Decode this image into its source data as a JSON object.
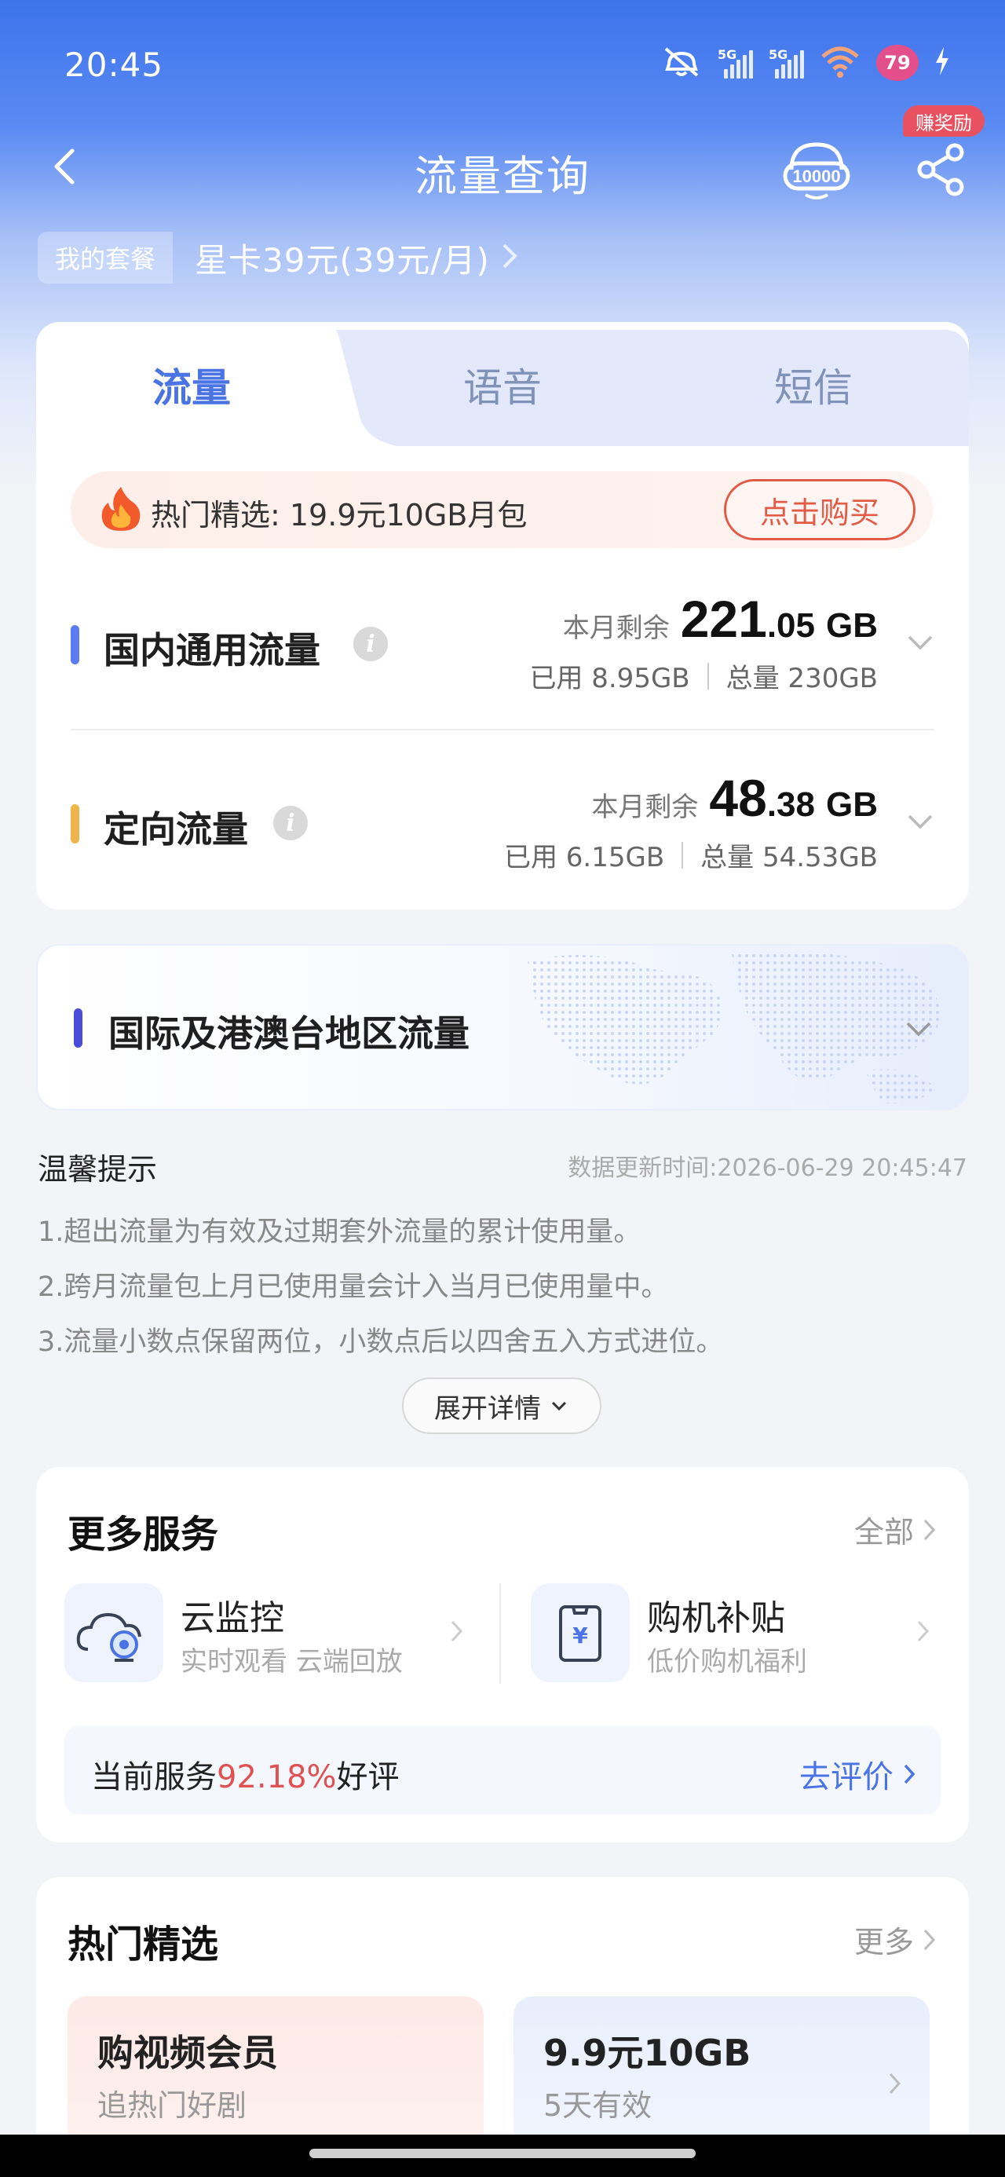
{
  "status_bar": {
    "time": "20:45",
    "network1": "5G",
    "network2": "5G",
    "battery": "79"
  },
  "nav": {
    "title": "流量查询",
    "reward_badge": "赚奖励"
  },
  "plan": {
    "tag": "我的套餐",
    "name": "星卡39元(39元/月)"
  },
  "tabs": [
    {
      "label": "流量",
      "active": true
    },
    {
      "label": "语音",
      "active": false
    },
    {
      "label": "短信",
      "active": false
    }
  ],
  "promo": {
    "text": "热门精选: 19.9元10GB月包",
    "button": "点击购买"
  },
  "flows": [
    {
      "name": "国内通用流量",
      "remain_label": "本月剩余",
      "remain_int": "221",
      "remain_dec": ".05",
      "unit": "GB",
      "used": "已用 8.95GB",
      "total": "总量 230GB",
      "color": "#5b7cf0"
    },
    {
      "name": "定向流量",
      "remain_label": "本月剩余",
      "remain_int": "48",
      "remain_dec": ".38",
      "unit": "GB",
      "used": "已用 6.15GB",
      "total": "总量 54.53GB",
      "color": "#f0b44c"
    }
  ],
  "intl": {
    "name": "国际及港澳台地区流量"
  },
  "tips": {
    "title": "温馨提示",
    "update_time": "数据更新时间:2026-06-29 20:45:47",
    "items": [
      "1.超出流量为有效及过期套外流量的累计使用量。",
      "2.跨月流量包上月已使用量会计入当月已使用量中。",
      "3.流量小数点保留两位，小数点后以四舍五入方式进位。"
    ],
    "expand": "展开详情"
  },
  "services": {
    "title": "更多服务",
    "more": "全部",
    "items": [
      {
        "name": "云监控",
        "desc": "实时观看 云端回放",
        "icon": "camera-cloud-icon"
      },
      {
        "name": "购机补贴",
        "desc": "低价购机福利",
        "icon": "phone-yuan-icon"
      }
    ],
    "rating_prefix": "当前服务",
    "rating_pct": "92.18%",
    "rating_suffix": "好评",
    "rating_link": "去评价"
  },
  "hot": {
    "title": "热门精选",
    "more": "更多",
    "items": [
      {
        "title": "购视频会员",
        "sub": "追热门好剧"
      },
      {
        "title": "9.9元10GB",
        "sub": "5天有效"
      }
    ]
  }
}
